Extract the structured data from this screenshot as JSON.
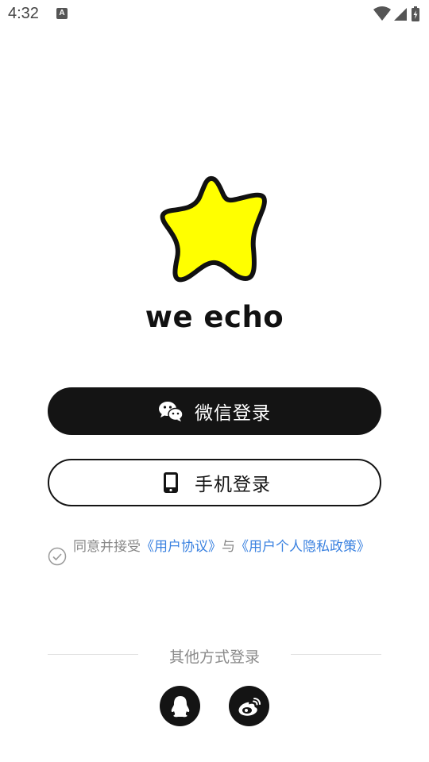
{
  "status_bar": {
    "time": "4:32",
    "notification_icon": "A",
    "icons": [
      "wifi-icon",
      "signal-icon",
      "battery-charging-icon"
    ]
  },
  "brand": {
    "name": "we echo",
    "logo_icon": "star-logo-icon",
    "logo_color": "#ffff00"
  },
  "buttons": {
    "wechat_label": "微信登录",
    "wechat_icon": "wechat-icon",
    "phone_label": "手机登录",
    "phone_icon": "phone-icon"
  },
  "agreement": {
    "prefix": "同意并接受",
    "user_agreement": "《用户协议》",
    "conjunction": "与",
    "privacy_policy": "《用户个人隐私政策》"
  },
  "other_login": {
    "title": "其他方式登录",
    "options": [
      "qq-icon",
      "weibo-icon"
    ]
  },
  "colors": {
    "primary": "#141414",
    "link": "#3b82e0",
    "muted_text": "#888888"
  }
}
